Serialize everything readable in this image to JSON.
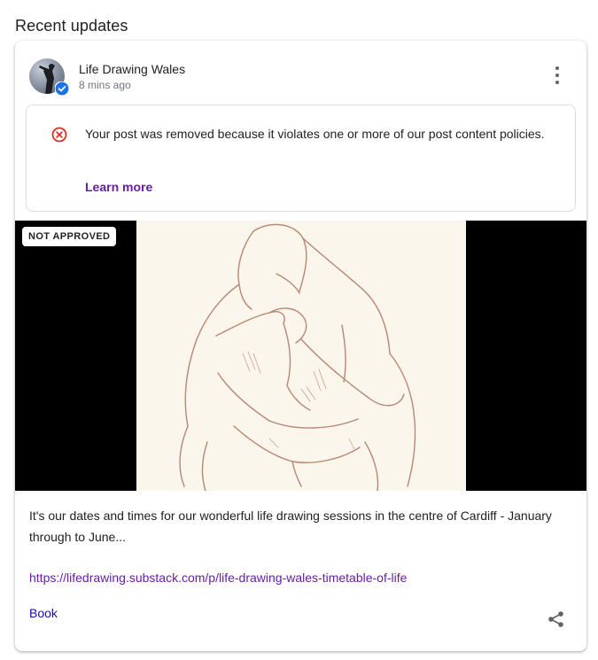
{
  "section": {
    "title": "Recent updates"
  },
  "post": {
    "author": "Life Drawing Wales",
    "timestamp": "8 mins ago",
    "notice": {
      "message": "Your post was removed because it violates one or more of our post content policies.",
      "learn_more": "Learn more",
      "icon": "error-circle-icon",
      "color": "#d93025"
    },
    "media": {
      "badge": "NOT APPROVED"
    },
    "summary": "It's our dates and times for our wonderful life drawing sessions in the centre of Cardiff - January through to June...",
    "link": "https://lifedrawing.substack.com/p/life-drawing-wales-timetable-of-life",
    "action": "Book",
    "icons": {
      "more": "more-vert-icon",
      "share": "share-icon",
      "verified": "verified-badge-icon"
    }
  },
  "colors": {
    "link": "#681da8",
    "action": "#1a0dab",
    "verified": "#1a73e8"
  }
}
